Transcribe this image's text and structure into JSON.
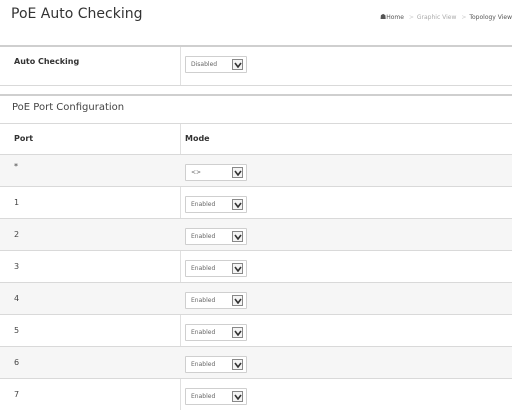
{
  "header": {
    "title": "PoE Auto Checking",
    "breadcrumb": [
      "Home",
      "Graphic View",
      "Topology View"
    ]
  },
  "auto_checking": {
    "label": "Auto Checking",
    "value": "Disabled"
  },
  "port_config": {
    "title": "PoE Port Configuration",
    "columns": [
      "Port",
      "Mode"
    ],
    "rows": [
      {
        "port": "*",
        "mode": "<>"
      },
      {
        "port": "1",
        "mode": "Enabled"
      },
      {
        "port": "2",
        "mode": "Enabled"
      },
      {
        "port": "3",
        "mode": "Enabled"
      },
      {
        "port": "4",
        "mode": "Enabled"
      },
      {
        "port": "5",
        "mode": "Enabled"
      },
      {
        "port": "6",
        "mode": "Enabled"
      },
      {
        "port": "7",
        "mode": "Enabled"
      }
    ]
  }
}
